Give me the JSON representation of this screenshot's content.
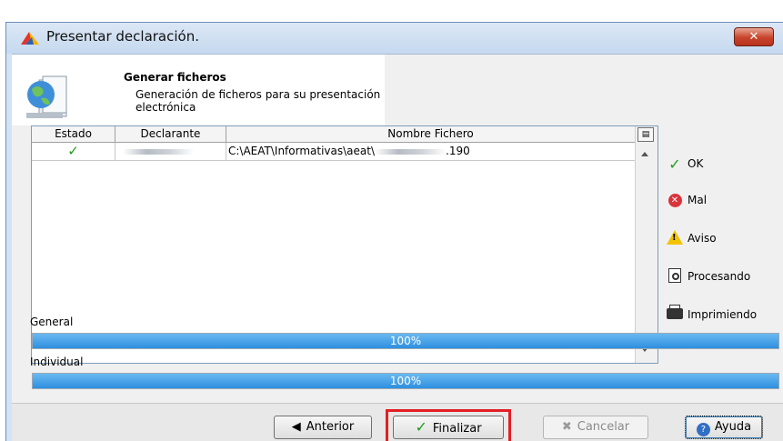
{
  "window": {
    "title": "Presentar declaración.",
    "close_label": "✕"
  },
  "header": {
    "title": "Generar ficheros",
    "subtitle": "Generación de ficheros para su presentación electrónica"
  },
  "table": {
    "columns": [
      "Estado",
      "Declarante",
      "Nombre Fichero"
    ],
    "rows": [
      {
        "estado_icon": "check-icon",
        "estado_glyph": "✓",
        "declarante": "",
        "fichero_prefix": "C:\\AEAT\\Informativas\\aeat\\",
        "fichero_suffix": ".190"
      }
    ],
    "corner_glyph": "▤"
  },
  "legend": {
    "ok": "OK",
    "mal": "Mal",
    "aviso": "Aviso",
    "procesando": "Procesando",
    "imprimiendo": "Imprimiendo"
  },
  "progress": {
    "general_label": "General",
    "general_value": 100,
    "general_text": "100%",
    "individual_label": "Individual",
    "individual_value": 100,
    "individual_text": "100%"
  },
  "buttons": {
    "anterior": "Anterior",
    "finalizar": "Finalizar",
    "cancelar": "Cancelar",
    "ayuda": "Ayuda"
  },
  "colors": {
    "accent_green": "#1f9a1f",
    "progress_blue": "#2e8fe0",
    "highlight_red": "#e31e24",
    "error_red": "#d9343a",
    "warning_yellow": "#f2c400"
  }
}
